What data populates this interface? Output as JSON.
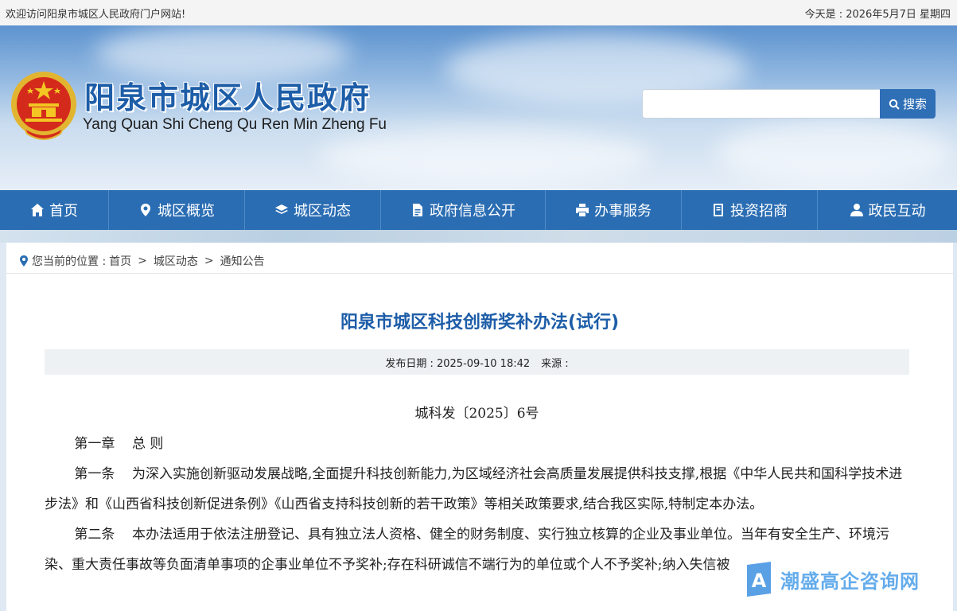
{
  "topbar": {
    "welcome": "欢迎访问阳泉市城区人民政府门户网站!",
    "date": "今天是 : 2026年5月7日 星期四"
  },
  "header": {
    "title": "阳泉市城区人民政府",
    "subtitle": "Yang Quan Shi Cheng Qu Ren Min Zheng Fu",
    "search_placeholder": "",
    "search_label": "搜索"
  },
  "nav": {
    "items": [
      {
        "label": "首页",
        "icon": "home-icon"
      },
      {
        "label": "城区概览",
        "icon": "location-pin-icon"
      },
      {
        "label": "城区动态",
        "icon": "layers-icon"
      },
      {
        "label": "政府信息公开",
        "icon": "document-icon"
      },
      {
        "label": "办事服务",
        "icon": "printer-icon"
      },
      {
        "label": "投资招商",
        "icon": "ledger-icon"
      },
      {
        "label": "政民互动",
        "icon": "user-icon"
      }
    ]
  },
  "breadcrumb": {
    "prefix": "您当前的位置 :",
    "items": [
      "首页",
      "城区动态",
      "通知公告"
    ],
    "separator": ">"
  },
  "article": {
    "title": "阳泉市城区科技创新奖补办法(试行)",
    "publish_label": "发布日期 : 2025-09-10 18:42",
    "source_label": "来源 :",
    "doc_no": "城科发〔2025〕6号",
    "chapter": "第一章    总 则",
    "para1": "第一条    为深入实施创新驱动发展战略,全面提升科技创新能力,为区域经济社会高质量发展提供科技支撑,根据《中华人民共和国科学技术进步法》和《山西省科技创新促进条例》《山西省支持科技创新的若干政策》等相关政策要求,结合我区实际,特制定本办法。",
    "para2": "第二条    本办法适用于依法注册登记、具有独立法人资格、健全的财务制度、实行独立核算的企业及事业单位。当年有安全生产、环境污染、重大责任事故等负面清单事项的企事业单位不予奖补;存在科研诚信不端行为的单位或个人不予奖补;纳入失信被"
  },
  "watermark": {
    "text": "潮盛高企咨询网",
    "logo_letter": "A"
  },
  "colors": {
    "nav_bg": "#2a6db3",
    "title_blue": "#1d5da8",
    "search_btn": "#2f6fb6"
  }
}
